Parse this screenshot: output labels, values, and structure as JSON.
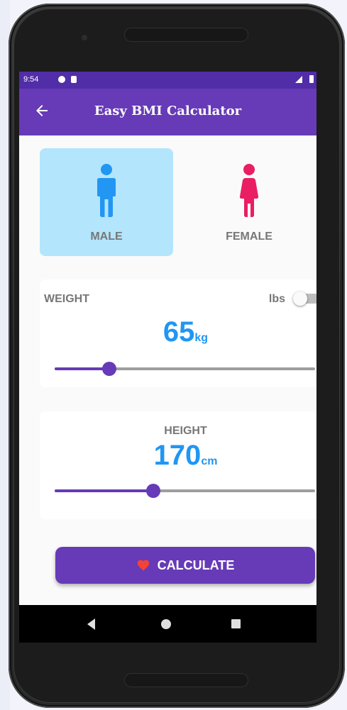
{
  "status_bar": {
    "time": "9:54"
  },
  "app_bar": {
    "title": "Easy BMI Calculator",
    "back_icon": "arrow-left-icon"
  },
  "gender": {
    "selected": "male",
    "male": {
      "label": "MALE",
      "icon": "male-person-icon",
      "color": "#2196f3",
      "card_bg": "#b3e5fc"
    },
    "female": {
      "label": "FEMALE",
      "icon": "female-person-icon",
      "color": "#e91e63"
    }
  },
  "weight": {
    "label": "WEIGHT",
    "value": "65",
    "unit": "kg",
    "toggle_label": "lbs",
    "toggle_on": false,
    "slider_fraction": 0.21
  },
  "height": {
    "label": "HEIGHT",
    "value": "170",
    "unit": "cm",
    "slider_fraction": 0.38
  },
  "calculate": {
    "label": "CALCULATE",
    "icon": "heart-icon"
  },
  "navigation": {
    "back": "nav-back-icon",
    "home": "nav-home-icon",
    "recents": "nav-recents-icon"
  },
  "colors": {
    "primary": "#673ab7",
    "primary_dark": "#512da8",
    "accent_blue": "#2196f3",
    "accent_pink": "#e91e63"
  }
}
